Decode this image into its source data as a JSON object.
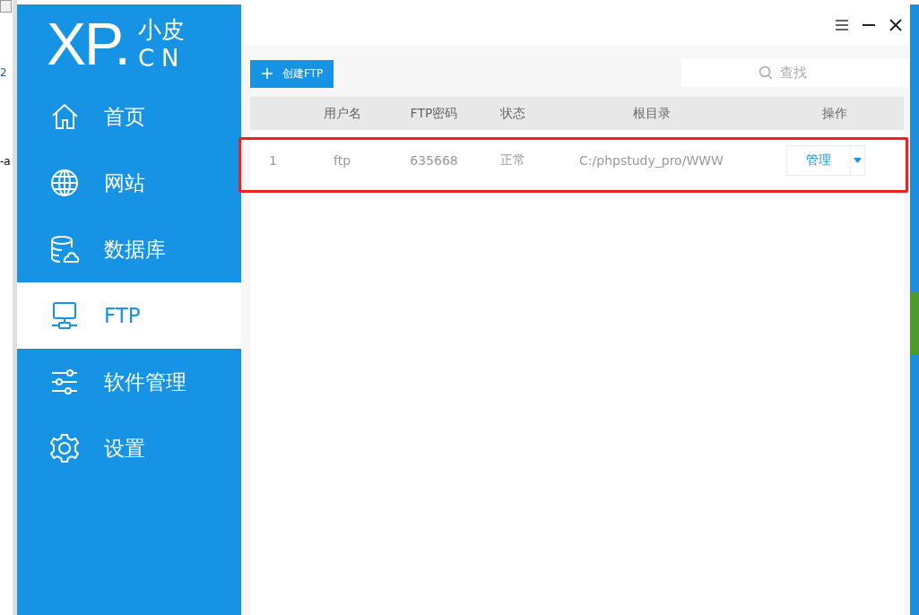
{
  "background_window": {
    "texts": [
      "2",
      "-a"
    ]
  },
  "logo": {
    "mark": "XP.",
    "top": "小皮",
    "bottom": "CN"
  },
  "sidebar": {
    "items": [
      {
        "label": "首页",
        "selected": false
      },
      {
        "label": "网站",
        "selected": false
      },
      {
        "label": "数据库",
        "selected": false
      },
      {
        "label": "FTP",
        "selected": true
      },
      {
        "label": "软件管理",
        "selected": false
      },
      {
        "label": "设置",
        "selected": false
      }
    ]
  },
  "toolbar": {
    "create_button": "创建FTP",
    "search": {
      "placeholder": "查找"
    }
  },
  "table": {
    "columns": [
      "",
      "用户名",
      "FTP密码",
      "状态",
      "根目录",
      "操作"
    ],
    "rows": [
      {
        "cells": [
          "1",
          "ftp",
          "635668",
          "正常",
          "C:/phpstudy_pro/WWW"
        ],
        "action": "管理"
      }
    ]
  }
}
